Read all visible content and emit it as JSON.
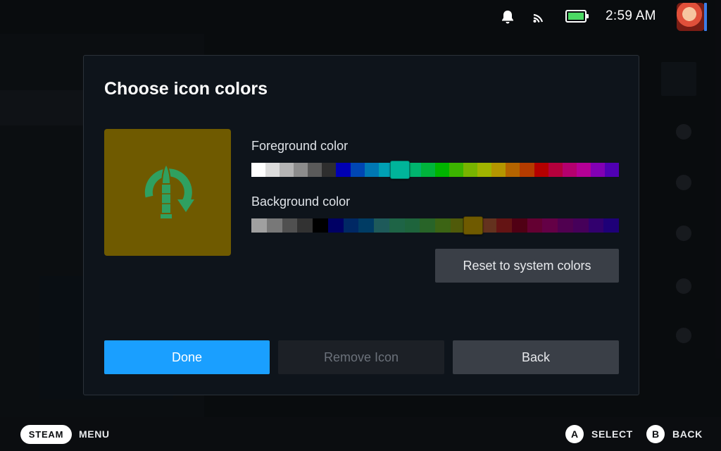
{
  "status": {
    "clock": "2:59 AM",
    "battery_level": 1.0,
    "icons": [
      "bell-icon",
      "wifi-icon",
      "battery-icon",
      "avatar"
    ]
  },
  "modal": {
    "title": "Choose icon colors",
    "foreground_label": "Foreground color",
    "background_label": "Background color",
    "reset_label": "Reset to system colors",
    "done_label": "Done",
    "remove_label": "Remove Icon",
    "back_label": "Back",
    "preview": {
      "icon": "bullet-refresh-icon",
      "fg_color": "#2fa060",
      "bg_color": "#6f5a00"
    },
    "foreground_palette": [
      "#ffffff",
      "#dcdcdc",
      "#b4b4b4",
      "#8c8c8c",
      "#5a5a5a",
      "#2e2e2e",
      "#0000b4",
      "#0046b4",
      "#0078b4",
      "#00a0b4",
      "#00b49a",
      "#00b46e",
      "#00b43c",
      "#00b400",
      "#3cb400",
      "#78b400",
      "#a0b400",
      "#b49600",
      "#b46400",
      "#b43c00",
      "#b40000",
      "#b4003c",
      "#b4006e",
      "#b40096",
      "#8200b4",
      "#5000b4"
    ],
    "foreground_selected_index": 10,
    "background_palette": [
      "#a0a0a0",
      "#787878",
      "#505050",
      "#323232",
      "#000000",
      "#000064",
      "#002864",
      "#003c64",
      "#1e5a5a",
      "#1e6446",
      "#1e643c",
      "#286428",
      "#3c6414",
      "#505a0a",
      "#6f5a00",
      "#64321e",
      "#641414",
      "#500014",
      "#640032",
      "#640046",
      "#500050",
      "#46005a",
      "#32006e",
      "#1e0078"
    ],
    "background_selected_index": 14
  },
  "footer": {
    "steam_label": "STEAM",
    "menu_label": "MENU",
    "a_glyph": "A",
    "select_label": "SELECT",
    "b_glyph": "B",
    "back_label": "BACK"
  }
}
